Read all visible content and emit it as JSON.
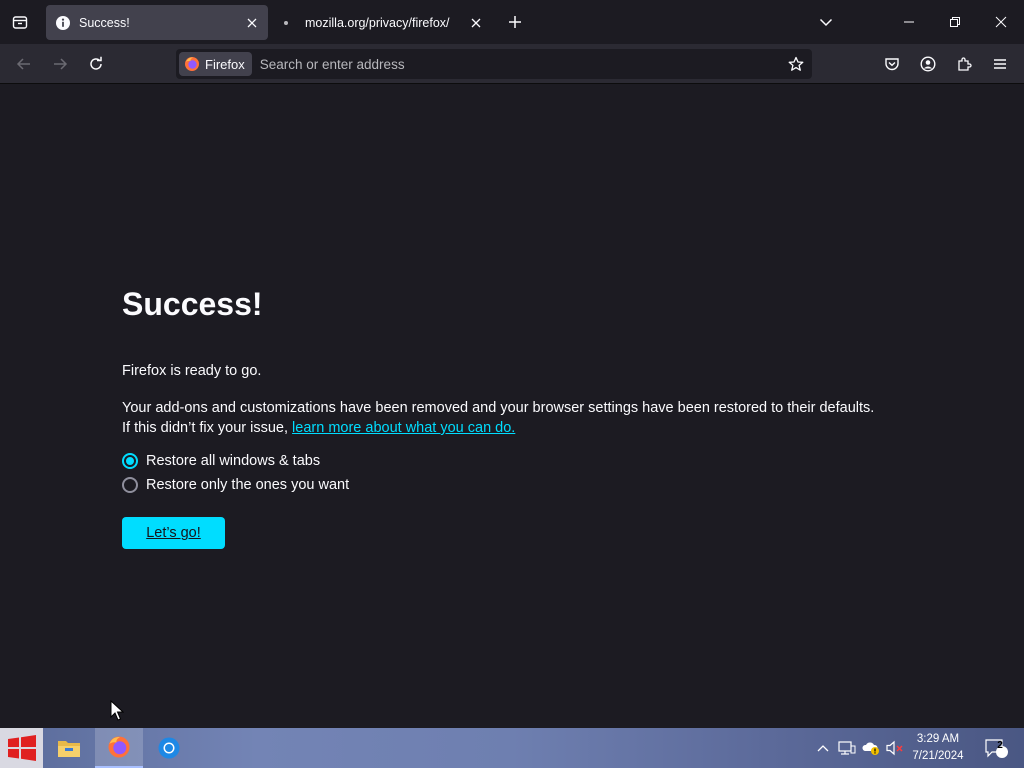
{
  "tabs": [
    {
      "title": "Success!",
      "favicon": "info-icon",
      "active": true
    },
    {
      "title": "mozilla.org/privacy/firefox/",
      "favicon": "dot-icon",
      "active": false
    }
  ],
  "navbar": {
    "identity_label": "Firefox",
    "url_placeholder": "Search or enter address"
  },
  "page": {
    "heading": "Success!",
    "ready_text": "Firefox is ready to go.",
    "info_text": "Your add-ons and customizations have been removed and your browser settings have been restored to their defaults.",
    "fix_text": "If this didn’t fix your issue, ",
    "learn_more_link": "learn more about what you can do.",
    "options": [
      {
        "label": "Restore all windows & tabs",
        "checked": true
      },
      {
        "label": "Restore only the ones you want",
        "checked": false
      }
    ],
    "go_button": "Let’s go!"
  },
  "taskbar": {
    "apps": [
      "file-explorer-icon",
      "firefox-icon",
      "chrome-icon"
    ],
    "time": "3:29 AM",
    "date": "7/21/2024",
    "notification_count": "2"
  },
  "colors": {
    "accent": "#00ddff",
    "background": "#1c1b22",
    "toolbar": "#2b2a33"
  }
}
